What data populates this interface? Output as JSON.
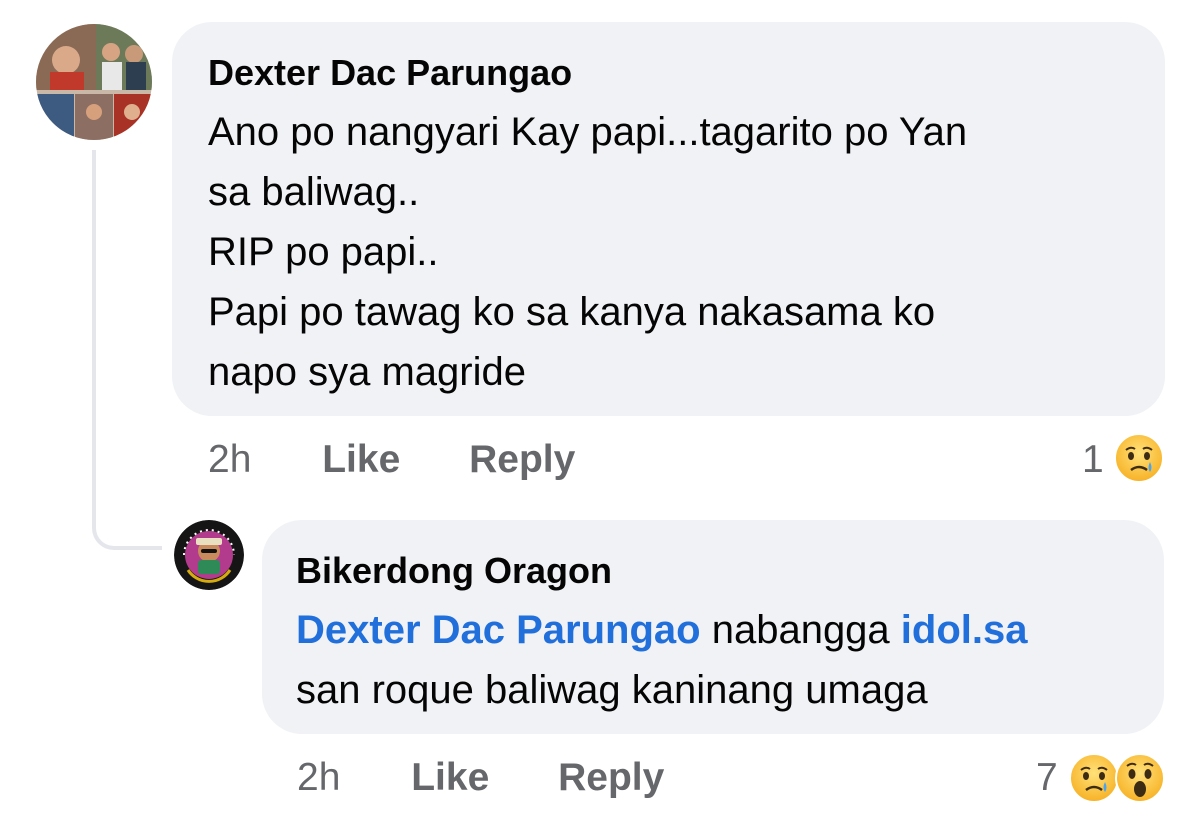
{
  "comments": [
    {
      "author": "Dexter Dac Parungao",
      "lines": [
        "Ano po nangyari Kay papi...tagarito po Yan",
        "sa baliwag..",
        "RIP po papi..",
        "Papi po tawag ko sa kanya nakasama ko",
        "napo sya magride"
      ],
      "time": "2h",
      "like_label": "Like",
      "reply_label": "Reply",
      "reaction_count": "1",
      "reactions": [
        "sad-icon"
      ]
    }
  ],
  "reply": {
    "author": "Bikerdong Oragon",
    "line1": {
      "mention": "Dexter Dac Parungao",
      "text": " nabangga ",
      "link": "idol.sa"
    },
    "line2": "san roque baliwag kaninang umaga",
    "time": "2h",
    "like_label": "Like",
    "reply_label": "Reply",
    "reaction_count": "7",
    "reactions": [
      "sad-icon",
      "wow-icon"
    ],
    "avatar_badge_text": "BIKERDONG"
  },
  "colors": {
    "bubble": "#f0f2f5",
    "mention": "#216fdb",
    "meta": "#65676b",
    "text": "#050505"
  }
}
